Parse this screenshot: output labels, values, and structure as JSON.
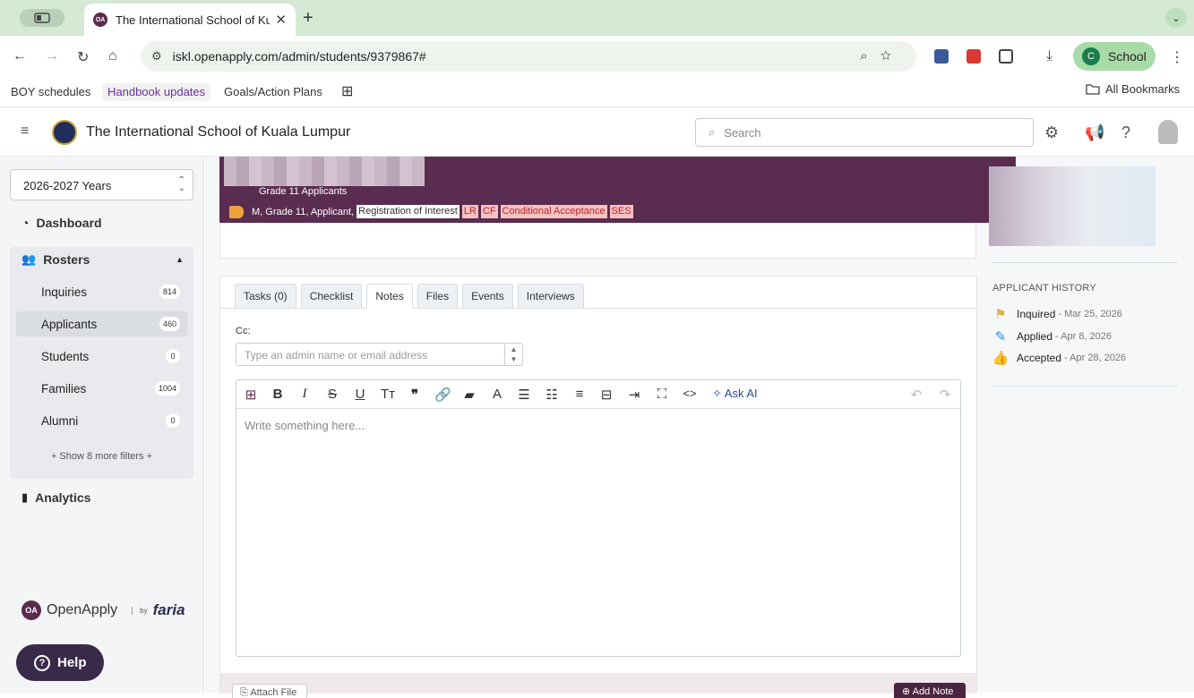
{
  "browser": {
    "tab_title": "The International School of Ku",
    "tab_favicon_text": "OA",
    "tab_close": "✕",
    "new_tab": "+",
    "tab_dropdown": "⌄",
    "url": "iskl.openapply.com/admin/students/9379867#",
    "profile_initial": "C",
    "profile_name": "School",
    "bookmarks": [
      "BOY schedules",
      "Handbook updates",
      "Goals/Action Plans"
    ],
    "all_bookmarks": "All Bookmarks"
  },
  "app": {
    "school_name": "The International School of Kuala Lumpur",
    "search_placeholder": "Search"
  },
  "sidebar": {
    "year_select": "2026-2027 Years",
    "dashboard": "Dashboard",
    "rosters": "Rosters",
    "items": [
      {
        "label": "Inquiries",
        "count": "814"
      },
      {
        "label": "Applicants",
        "count": "460"
      },
      {
        "label": "Students",
        "count": "0"
      },
      {
        "label": "Families",
        "count": "1004"
      },
      {
        "label": "Alumni",
        "count": "0"
      }
    ],
    "more_filters": "+ Show 8 more filters +",
    "analytics": "Analytics",
    "brand": "OpenApply",
    "brand_mark": "OA",
    "by": "by",
    "faria": "faria",
    "help": "Help"
  },
  "header": {
    "grade_group": "Grade 11 Applicants",
    "tags_prefix": "M, Grade 11, Applicant,",
    "tags": [
      {
        "label": "Registration of Interest",
        "style": "white"
      },
      {
        "label": "LR",
        "style": "red"
      },
      {
        "label": "CF",
        "style": "red"
      },
      {
        "label": "Conditional Acceptance",
        "style": "red"
      },
      {
        "label": "SES",
        "style": "red"
      }
    ]
  },
  "history": {
    "title": "APPLICANT HISTORY",
    "events": [
      {
        "label": "Inquired",
        "date": "- Mar 25, 2026",
        "icon": "flag-icon",
        "color": "#e0b34a"
      },
      {
        "label": "Applied",
        "date": "- Apr 8, 2026",
        "icon": "edit-icon",
        "color": "#2f8fd0"
      },
      {
        "label": "Accepted",
        "date": "- Apr 28, 2026",
        "icon": "thumbs-up-icon",
        "color": "#2aa37a"
      }
    ]
  },
  "notes": {
    "tabs": [
      "Tasks (0)",
      "Checklist",
      "Notes",
      "Files",
      "Events",
      "Interviews"
    ],
    "active_tab": "Notes",
    "cc_label": "Cc:",
    "cc_placeholder": "Type an admin name or email address",
    "editor_placeholder": "Write something here...",
    "ask_ai": "Ask AI",
    "attach_file": "Attach File",
    "add_note": "Add Note"
  },
  "colors": {
    "brand_purple": "#5a2d50",
    "help_button": "#3a2a4a",
    "tag_red": "#c0262e"
  }
}
